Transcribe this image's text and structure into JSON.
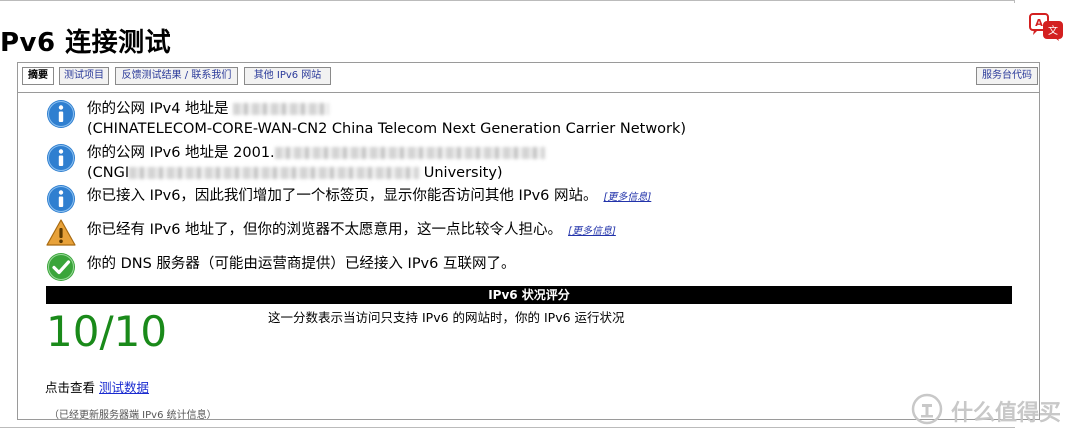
{
  "page": {
    "title": "Pv6 连接测试"
  },
  "tabs": {
    "summary": "摘要",
    "tests": "测试项目",
    "feedback": "反馈测试结果 / 联系我们",
    "other": "其他 IPv6 网站",
    "helpdesk": "服务台代码"
  },
  "rows": {
    "ipv4_line1": "你的公网 IPv4 地址是",
    "ipv4_line2": "(CHINATELECOM-CORE-WAN-CN2 China Telecom Next Generation Carrier Network)",
    "ipv6_line1": "你的公网 IPv6 地址是 2001.",
    "ipv6_line2_prefix": "(CNGI",
    "ipv6_line2_suffix": "University)",
    "tab_added": "你已接入 IPv6，因此我们增加了一个标签页，显示你能否访问其他 IPv6 网站。",
    "browser_warn": "你已经有 IPv6 地址了，但你的浏览器不太愿意用，这一点比较令人担心。",
    "dns_ok": "你的 DNS 服务器（可能由运营商提供）已经接入 IPv6 互联网了。",
    "more_info": "[更多信息]"
  },
  "score": {
    "header": "IPv6 状况评分",
    "value": "10/10",
    "description": "这一分数表示当访问只支持 IPv6 的网站时，你的 IPv6 运行状况"
  },
  "links": {
    "test_data_prefix": "点击查看",
    "test_data_link": "测试数据"
  },
  "footnote": "（已经更新服务器端 IPv6 统计信息）",
  "watermark": "什么值得买",
  "colors": {
    "info_blue": "#2f7fd0",
    "warn_orange": "#e8a23a",
    "ok_green": "#3aa53a",
    "score_green": "#1a8a1a",
    "link_blue": "#1a2bd0",
    "translate_red": "#d32020"
  }
}
